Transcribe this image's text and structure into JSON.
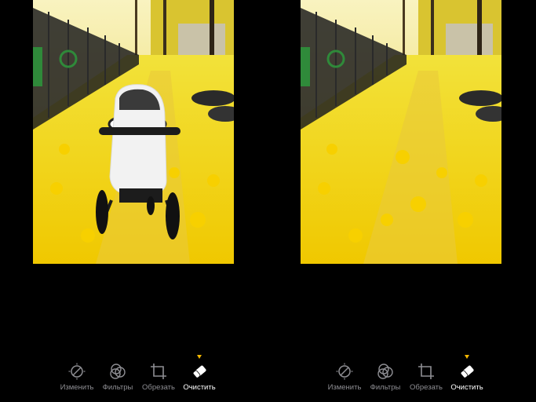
{
  "toolbar": {
    "items": [
      {
        "label": "Изменить",
        "icon": "adjust-icon"
      },
      {
        "label": "Фильтры",
        "icon": "filters-icon"
      },
      {
        "label": "Обрезать",
        "icon": "crop-icon"
      },
      {
        "label": "Очистить",
        "icon": "eraser-icon"
      }
    ],
    "active_index": 3,
    "active_color": "#f5b800",
    "inactive_color": "#8e8e93"
  }
}
